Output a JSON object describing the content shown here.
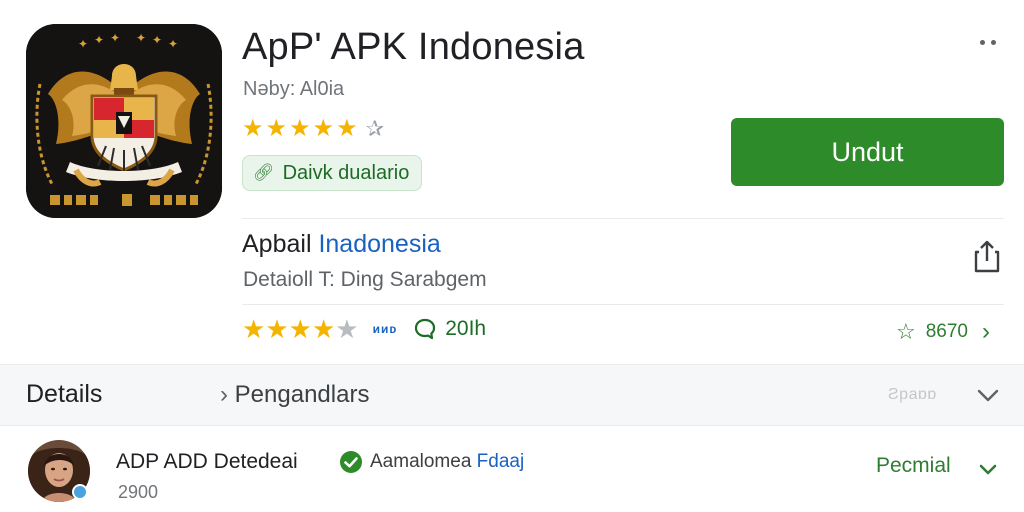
{
  "app": {
    "title": "ApP' APK Indonesia",
    "developer": "Nəby: Al0ia",
    "rating_stars": 5,
    "chip_label": "Daivk dualario",
    "download_label": "Undut"
  },
  "about": {
    "title_plain": "Apbail",
    "title_link": "Inadonesia",
    "subtitle": "Detaioll T: Ding Sarabgem",
    "rating_stars": 4,
    "small_badge": "ᴎᴎᴅ",
    "review_count": "20Ih",
    "fav_value": "8670"
  },
  "details": {
    "label": "Details",
    "link_label": "Pengandlars",
    "right_text": "Ƨpaɒɒ"
  },
  "review": {
    "name": "ADP ADD Detedeai",
    "verified_text": "Aamalomea",
    "verified_link": "Fdaaj",
    "meta": "2900",
    "premium_label": "Pecmial"
  },
  "colors": {
    "accent_green": "#2e8b2a",
    "star_gold": "#f5b400",
    "link_blue": "#1a62c0"
  }
}
